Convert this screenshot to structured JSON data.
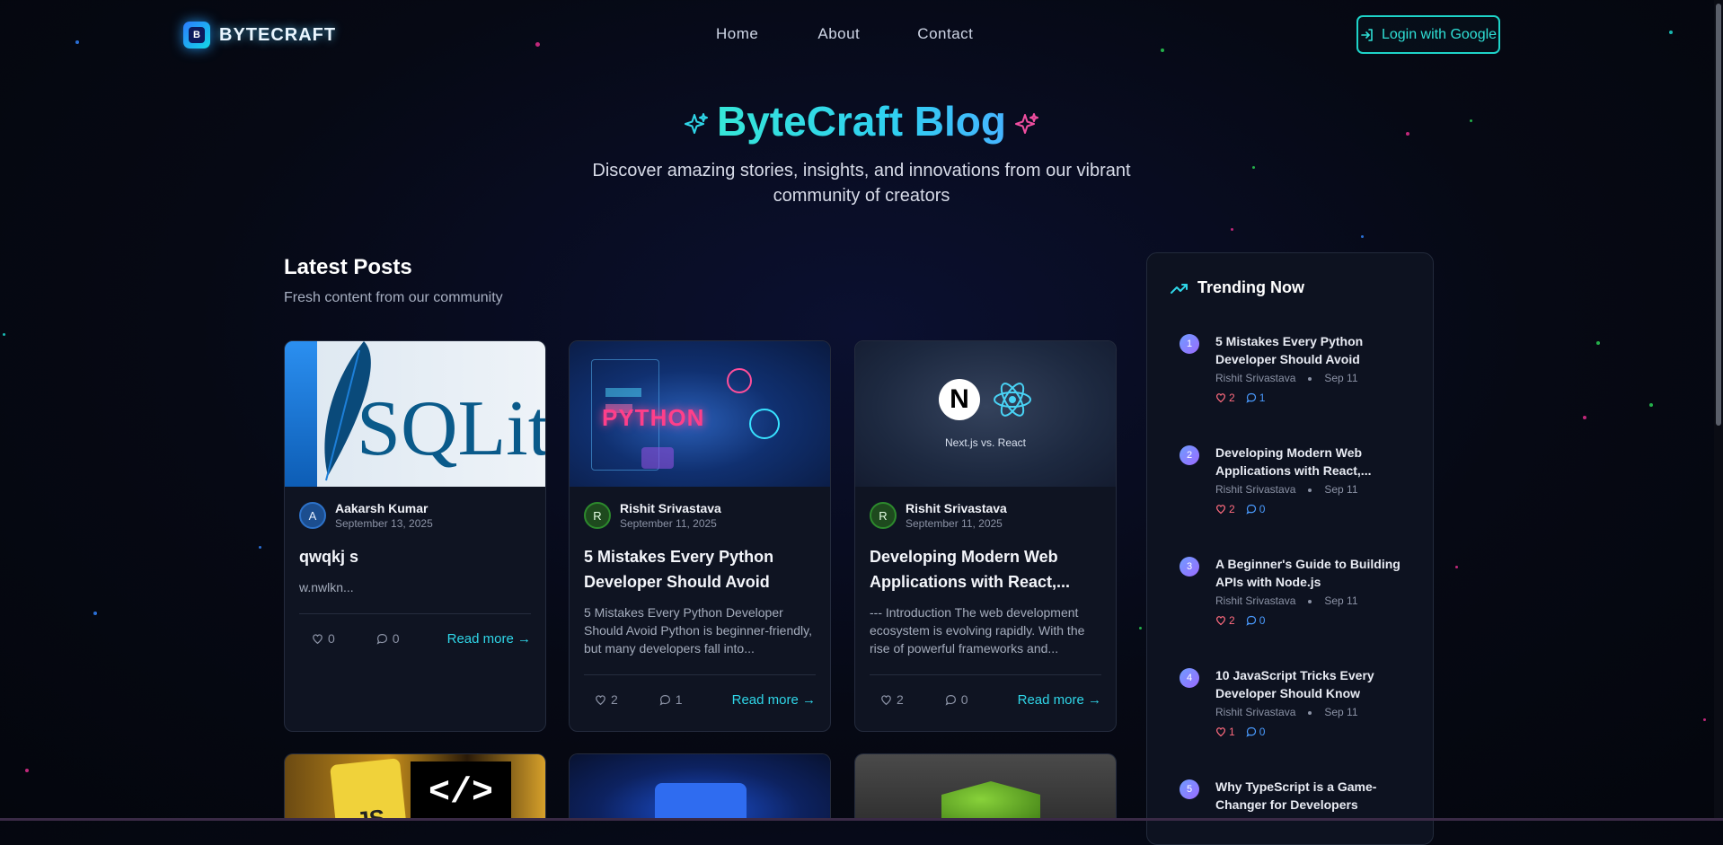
{
  "brand": {
    "logo_letter": "B",
    "name": "BYTECRAFT"
  },
  "nav": {
    "items": [
      "Home",
      "About",
      "Contact"
    ]
  },
  "login": {
    "label": "Login with Google"
  },
  "hero": {
    "title": "ByteCraft Blog",
    "subtitle": "Discover amazing stories, insights, and innovations from our vibrant community of creators"
  },
  "latest": {
    "title": "Latest Posts",
    "subtitle": "Fresh content from our community"
  },
  "posts": [
    {
      "author": "Aakarsh Kumar",
      "initial": "A",
      "date": "September 13, 2025",
      "title": "qwqkj s",
      "excerpt": "w.nwlkn...",
      "likes": "0",
      "comments": "0",
      "read": "Read more →",
      "image_text": "SQLit"
    },
    {
      "author": "Rishit Srivastava",
      "initial": "R",
      "date": "September 11, 2025",
      "title": "5 Mistakes Every Python Developer Should Avoid",
      "excerpt": "5 Mistakes Every Python Developer Should Avoid Python is beginner-friendly, but many developers fall into...",
      "likes": "2",
      "comments": "1",
      "read": "Read more →",
      "image_text": "PYTHON"
    },
    {
      "author": "Rishit Srivastava",
      "initial": "R",
      "date": "September 11, 2025",
      "title": "Developing Modern Web Applications with React,...",
      "excerpt": "--- Introduction The web development ecosystem is evolving rapidly. With the rise of powerful frameworks and...",
      "likes": "2",
      "comments": "0",
      "read": "Read more →",
      "image_text": "Next.js vs. React"
    }
  ],
  "trending": {
    "title": "Trending Now",
    "items": [
      {
        "num": "1",
        "title": "5 Mistakes Every Python Developer Should Avoid",
        "author": "Rishit Srivastava",
        "date": "Sep 11",
        "likes": "2",
        "comments": "1"
      },
      {
        "num": "2",
        "title": "Developing Modern Web Applications with React,...",
        "author": "Rishit Srivastava",
        "date": "Sep 11",
        "likes": "2",
        "comments": "0"
      },
      {
        "num": "3",
        "title": "A Beginner's Guide to Building APIs with Node.js",
        "author": "Rishit Srivastava",
        "date": "Sep 11",
        "likes": "2",
        "comments": "0"
      },
      {
        "num": "4",
        "title": "10 JavaScript Tricks Every Developer Should Know",
        "author": "Rishit Srivastava",
        "date": "Sep 11",
        "likes": "1",
        "comments": "0"
      },
      {
        "num": "5",
        "title": "Why TypeScript is a Game-Changer for Developers",
        "author": "",
        "date": "",
        "likes": "",
        "comments": ""
      }
    ]
  },
  "colors": {
    "accent": "#2fd6e8",
    "login_border": "#1ed3c8",
    "like": "#ff6b7e",
    "comment": "#4a9bff"
  }
}
